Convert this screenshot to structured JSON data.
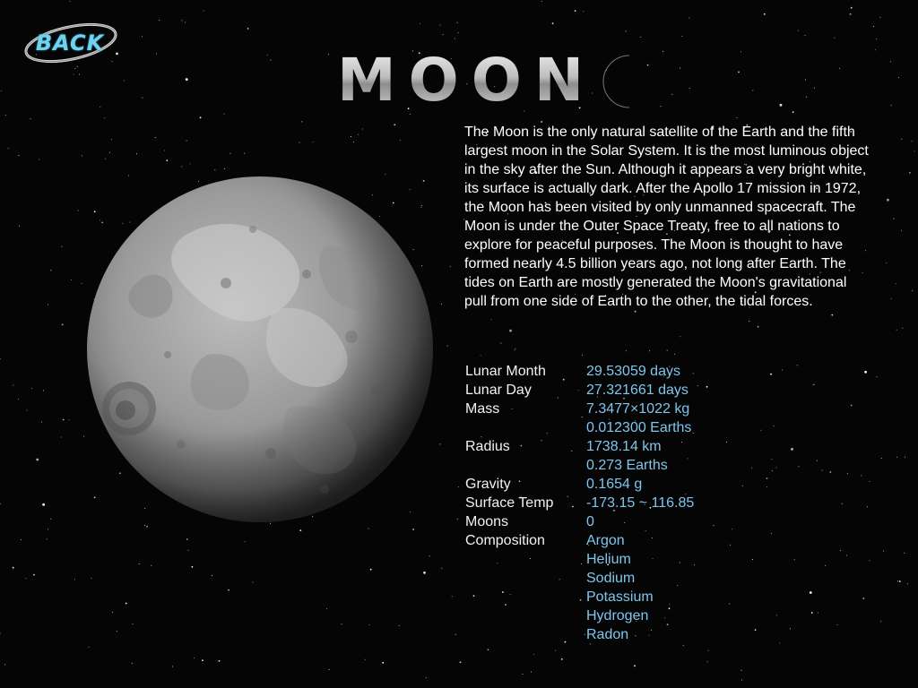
{
  "back": {
    "label": "BACK",
    "accent": "#6fd3ee"
  },
  "title": {
    "text": "MOON",
    "icon": "crescent-moon-icon"
  },
  "description": "The Moon is the only natural satellite of the Earth and the fifth largest moon in the Solar System. It is the most luminous object in the sky after the Sun. Although it appears a very bright white, its surface is actually dark. After the Apollo 17 mission in 1972, the Moon has been visited by only unmanned spacecraft. The Moon is under the Outer Space Treaty, free to all nations to explore for peaceful purposes. The Moon is thought to have formed nearly 4.5 billion years ago, not long after Earth. The tides on Earth are mostly generated the Moon's gravitational pull from one side of Earth to the other, the tidal forces.",
  "facts": [
    {
      "label": "Lunar Month",
      "values": [
        "29.53059 days"
      ]
    },
    {
      "label": "Lunar Day",
      "values": [
        "27.321661 days"
      ]
    },
    {
      "label": "Mass",
      "values": [
        "7.3477×1022 kg",
        "0.012300 Earths"
      ]
    },
    {
      "label": "Radius",
      "values": [
        "1738.14 km",
        "0.273 Earths"
      ]
    },
    {
      "label": "Gravity",
      "values": [
        "0.1654 g"
      ]
    },
    {
      "label": "Surface Temp",
      "values": [
        "-173.15 ~ 116.85"
      ]
    },
    {
      "label": "Moons",
      "values": [
        "0"
      ]
    },
    {
      "label": "Composition",
      "values": [
        "Argon",
        "Helium",
        "Sodium",
        "Potassium",
        "Hydrogen",
        "Radon"
      ]
    }
  ],
  "colors": {
    "background": "#050505",
    "text": "#ffffff",
    "value": "#7fc6ee"
  }
}
